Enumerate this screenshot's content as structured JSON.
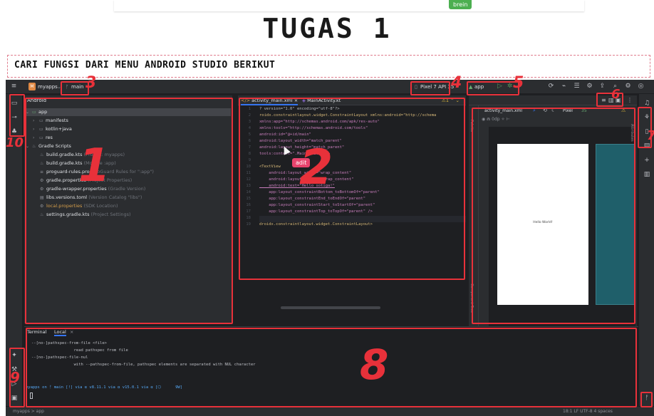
{
  "slide": {
    "badge": "brein",
    "title": "TUGAS 1",
    "subtitle": "CARI FUNGSI DARI MENU ANDROID STUDIO BERIKUT"
  },
  "titlebar": {
    "project_letter": "M",
    "project": "myapps",
    "branch": "main",
    "device": "Pixel 7 API 35",
    "run_config": "app"
  },
  "project_panel": {
    "view": "Android",
    "tree": [
      {
        "label": "app",
        "note": ""
      },
      {
        "label": "manifests",
        "note": ""
      },
      {
        "label": "kotlin+java",
        "note": ""
      },
      {
        "label": "res",
        "note": ""
      },
      {
        "label": "Gradle Scripts",
        "note": ""
      },
      {
        "label": "build.gradle.kts",
        "note": "(Project: myapps)"
      },
      {
        "label": "build.gradle.kts",
        "note": "(Module :app)"
      },
      {
        "label": "proguard-rules.pro",
        "note": "(ProGuard Rules for \":app\")"
      },
      {
        "label": "gradle.properties",
        "note": "(Project Properties)"
      },
      {
        "label": "gradle-wrapper.properties",
        "note": "(Gradle Version)"
      },
      {
        "label": "libs.versions.toml",
        "note": "(Version Catalog \"libs\")"
      },
      {
        "label": "local.properties",
        "note": "(SDK Location)"
      },
      {
        "label": "settings.gradle.kts",
        "note": "(Project Settings)"
      }
    ]
  },
  "editor": {
    "tabs": [
      "activity_main.xml",
      "MainActivity.kt"
    ],
    "warning": "1",
    "lines": [
      "? version=\"1.0\" encoding=\"utf-8\"?>",
      "roidx.constraintlayout.widget.ConstraintLayout xmlns:android=\"http://schema",
      "xmlns:app=\"http://schemas.android.com/apk/res-auto\"",
      "xmlns:tools=\"http://schemas.android.com/tools\"",
      "android:id=\"@+id/main\"",
      "android:layout_width=\"match_parent\"",
      "android:layout_height=\"match_parent\"",
      "tools:context=\".MainActivity\">",
      "",
      "<TextView",
      "    android:layout_width=\"wrap_content\"",
      "    android:layout_height=\"wrap_content\"",
      "    android:text=\"Hello sotiga!\"",
      "    app:layout_constraintBottom_toBottomOf=\"parent\"",
      "    app:layout_constraintEnd_toEndOf=\"parent\"",
      "    app:layout_constraintStart_toStartOf=\"parent\"",
      "    app:layout_constraintTop_toTopOf=\"parent\" />",
      "",
      "droidx.constraintlayout.widget.ConstraintLayout>"
    ],
    "line_numbers": [
      "1",
      "2",
      "3",
      "4",
      "5",
      "6",
      "7",
      "8",
      "9",
      "10",
      "11",
      "12",
      "13",
      "14",
      "15",
      "16",
      "17",
      "18",
      "19"
    ],
    "chip": "adit"
  },
  "design": {
    "file": "activity_main.xml",
    "device": "Pixel",
    "api": "35",
    "phone_text": "Hello World!",
    "palette_label": "Palette",
    "component_tree_label": "Component Tree",
    "attributes_label": "Attributes"
  },
  "terminal": {
    "tabs": [
      "Terminal",
      "Local"
    ],
    "lines": [
      "--[no-]pathspec-from-file <file>",
      "                  read pathspec from file",
      "--[no-]pathspec-file-nul",
      "                  with --pathspec-from-file, pathspec elements are separated with NUL character"
    ],
    "prompt": "myapps on ᚠ main [!] via ⍺ v8.11.1 via ⍺ v15.0.1 via ⍺ [⬡      9W]"
  },
  "statusbar": {
    "breadcrumb": "myapps > app",
    "right": "18:1   LF   UTF-8      4 spaces"
  },
  "annotations": [
    "1",
    "2",
    "3",
    "4",
    "5",
    "6",
    "7",
    "8",
    "9",
    "10"
  ]
}
